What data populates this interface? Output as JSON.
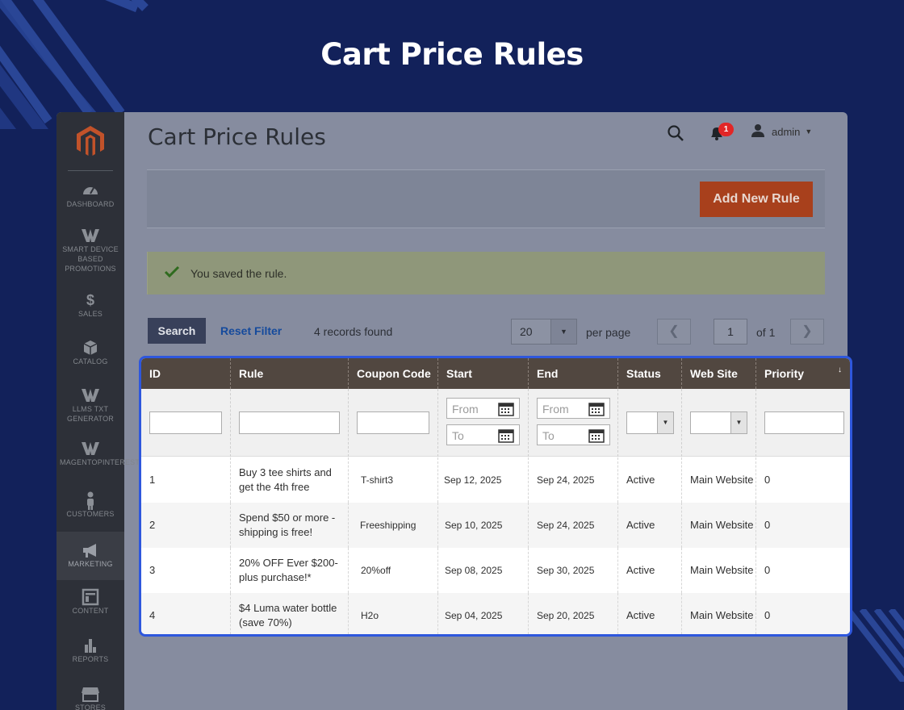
{
  "hero": {
    "title": "Cart Price Rules"
  },
  "sidebar": {
    "items": [
      {
        "label": "Dashboard",
        "icon": "dashboard-icon"
      },
      {
        "label": "Smart Device Based Promotions",
        "icon": "w-logo-icon"
      },
      {
        "label": "Sales",
        "icon": "dollar-icon"
      },
      {
        "label": "Catalog",
        "icon": "cube-icon"
      },
      {
        "label": "LLMS TXT Generator",
        "icon": "w-logo-icon"
      },
      {
        "label": "MagentoPinterest",
        "icon": "w-logo-icon"
      },
      {
        "label": "Customers",
        "icon": "person-icon"
      },
      {
        "label": "Marketing",
        "icon": "megaphone-icon"
      },
      {
        "label": "Content",
        "icon": "layout-icon"
      },
      {
        "label": "Reports",
        "icon": "bar-chart-icon"
      },
      {
        "label": "Stores",
        "icon": "store-icon"
      }
    ],
    "active": "Marketing"
  },
  "header": {
    "title": "Cart Price Rules",
    "notifications_count": "1",
    "user": "admin"
  },
  "actions": {
    "add_new_rule": "Add New Rule"
  },
  "message": {
    "text": "You saved the rule."
  },
  "toolbar": {
    "search_label": "Search",
    "reset_filter_label": "Reset Filter",
    "records_found": "4 records found",
    "per_page_value": "20",
    "per_page_label": "per page",
    "page_current": "1",
    "page_of": "of 1"
  },
  "grid": {
    "columns": [
      "ID",
      "Rule",
      "Coupon Code",
      "Start",
      "End",
      "Status",
      "Web Site",
      "Priority"
    ],
    "filters": {
      "from_placeholder": "From",
      "to_placeholder": "To"
    },
    "rows": [
      {
        "id": "1",
        "rule": "Buy 3 tee shirts and get the 4th free",
        "coupon": "T-shirt3",
        "start": "Sep 12, 2025",
        "end": "Sep 24, 2025",
        "status": "Active",
        "website": "Main Website",
        "priority": "0"
      },
      {
        "id": "2",
        "rule": "Spend $50 or more - shipping is free!",
        "coupon": "Freeshipping",
        "start": "Sep 10, 2025",
        "end": "Sep 24, 2025",
        "status": "Active",
        "website": "Main Website",
        "priority": "0"
      },
      {
        "id": "3",
        "rule": "20% OFF Ever $200-plus purchase!*",
        "coupon": "20%off",
        "start": "Sep 08, 2025",
        "end": "Sep 30, 2025",
        "status": "Active",
        "website": "Main Website",
        "priority": "0"
      },
      {
        "id": "4",
        "rule": "$4 Luma water bottle (save 70%)",
        "coupon": "H2o",
        "start": "Sep 04, 2025",
        "end": "Sep 20, 2025",
        "status": "Active",
        "website": "Main Website",
        "priority": "0"
      }
    ]
  },
  "colors": {
    "background": "#12215a",
    "header_row": "#514740",
    "add_button": "#a8401c",
    "highlight_border": "#2e57dd"
  }
}
